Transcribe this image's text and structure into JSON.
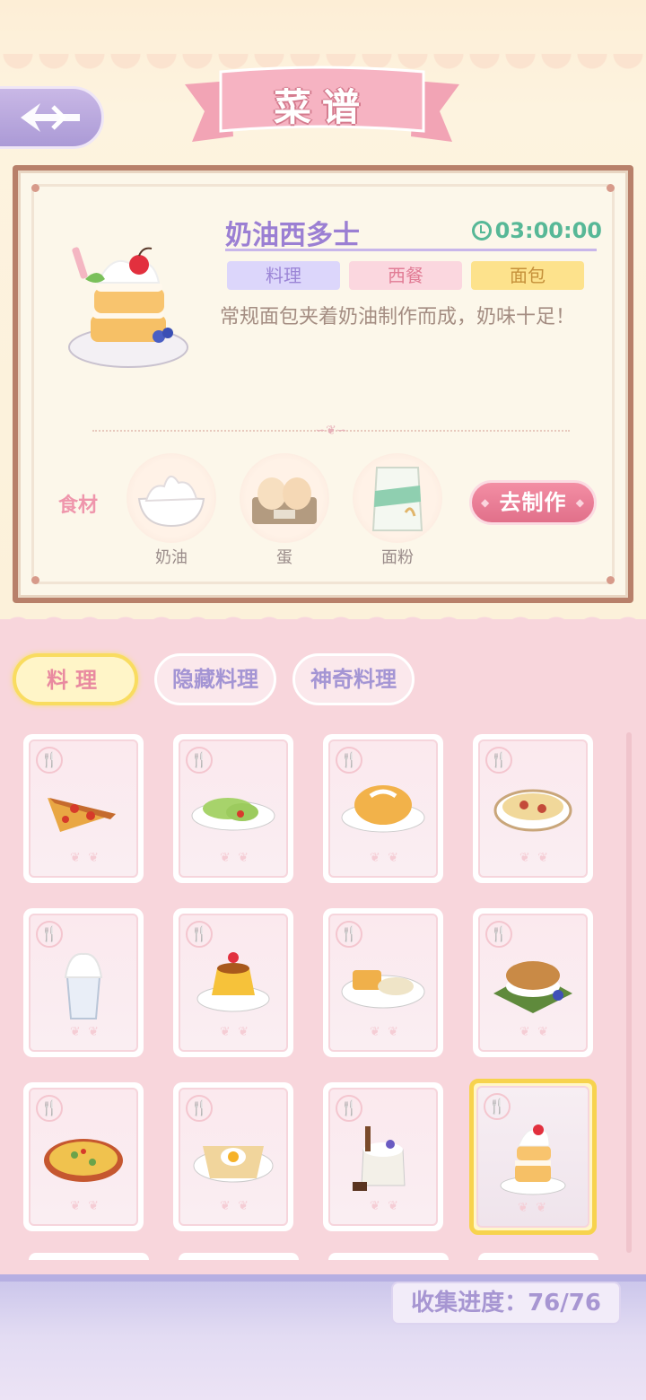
{
  "header": {
    "title": "菜谱",
    "back_icon": "back-arrow-icon"
  },
  "detail": {
    "name": "奶油西多士",
    "time": "03:00:00",
    "tags": [
      "料理",
      "西餐",
      "面包"
    ],
    "description": "常规面包夹着奶油制作而成，奶味十足！",
    "ingredients_label": "食材",
    "ingredients": [
      {
        "name": "奶油",
        "icon": "cream-bowl-icon"
      },
      {
        "name": "蛋",
        "icon": "eggs-carton-icon"
      },
      {
        "name": "面粉",
        "icon": "flour-bag-icon"
      }
    ],
    "make_button": "去制作"
  },
  "tabs": [
    {
      "label": "料理",
      "active": true
    },
    {
      "label": "隐藏料理",
      "active": false
    },
    {
      "label": "神奇料理",
      "active": false
    }
  ],
  "recipes": [
    {
      "icon": "pizza-slice-icon"
    },
    {
      "icon": "wrap-roll-icon"
    },
    {
      "icon": "bread-bun-icon"
    },
    {
      "icon": "stew-bowl-icon"
    },
    {
      "icon": "milkshake-icon"
    },
    {
      "icon": "pudding-icon"
    },
    {
      "icon": "toast-soup-icon"
    },
    {
      "icon": "burger-icon"
    },
    {
      "icon": "pizza-whole-icon"
    },
    {
      "icon": "egg-crepe-icon"
    },
    {
      "icon": "yogurt-jar-icon"
    },
    {
      "icon": "cream-toast-icon",
      "selected": true
    }
  ],
  "footer": {
    "progress_label": "收集进度：76/76"
  },
  "colors": {
    "accent_pink": "#e1708a",
    "accent_purple": "#9b7fd3",
    "time_green": "#57b897",
    "selected_gold": "#f7d34d"
  }
}
